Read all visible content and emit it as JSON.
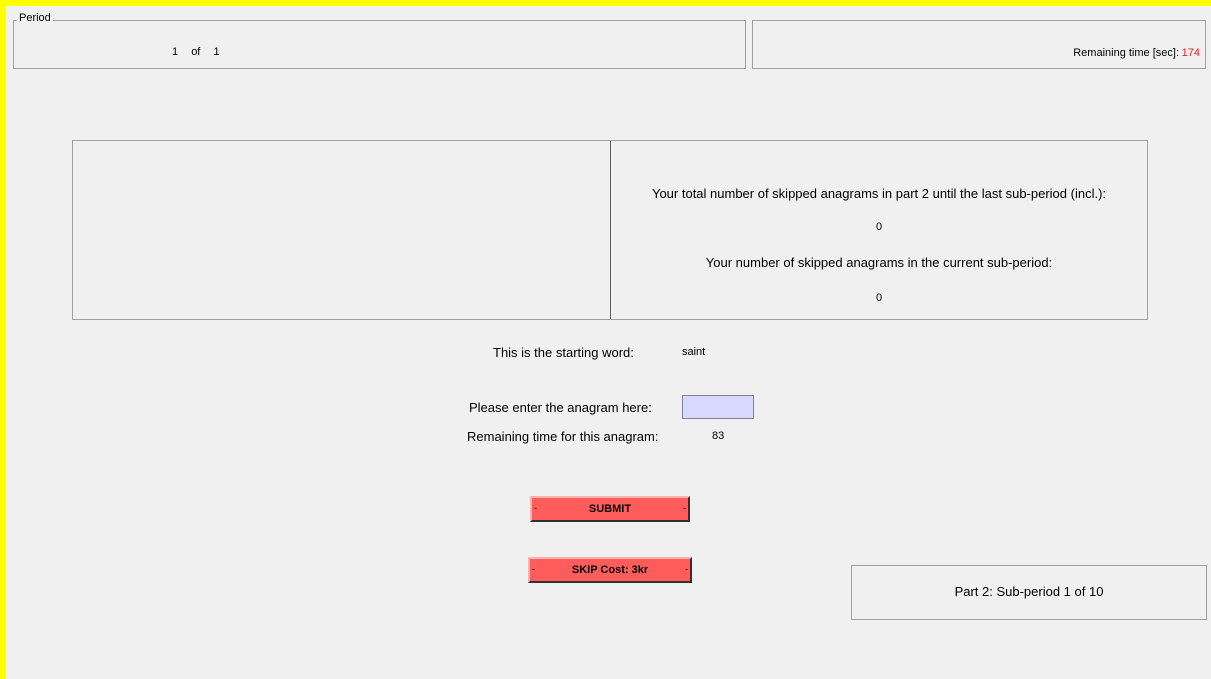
{
  "period": {
    "legend": "Period",
    "current": "1",
    "of_label": "of",
    "total": "1"
  },
  "timer": {
    "label": "Remaining time [sec]:",
    "value": "174",
    "value_color": "#e52020"
  },
  "info": {
    "total_skipped_label": "Your total number of skipped anagrams in part 2 until the last sub-period (incl.):",
    "total_skipped_value": "0",
    "current_skipped_label": "Your number of skipped anagrams in the current sub-period:",
    "current_skipped_value": "0"
  },
  "task": {
    "starting_word_label": "This is the starting word:",
    "starting_word": "saint",
    "anagram_prompt": "Please enter the anagram here:",
    "anagram_value": "",
    "anagram_time_label": "Remaining time for this anagram:",
    "anagram_time_value": "83"
  },
  "buttons": {
    "submit_label": "SUBMIT",
    "skip_label": "SKIP Cost: 3kr",
    "dash": "-",
    "color": "#ff5c5c"
  },
  "part": {
    "label": "Part 2: Sub-period 1 of 10"
  },
  "colors": {
    "window_border": "#ffff00",
    "background": "#f0f0f0",
    "input_bg": "#d8d8ff"
  }
}
